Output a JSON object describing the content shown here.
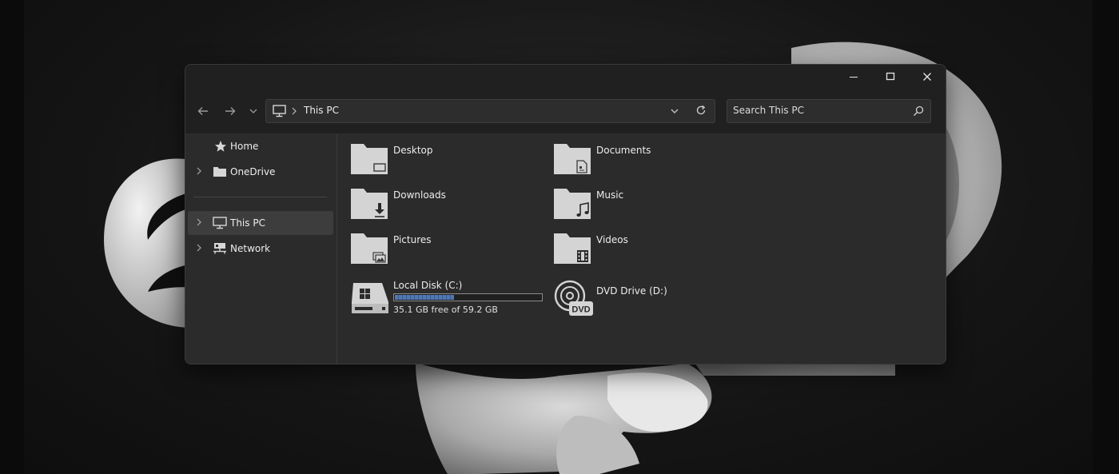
{
  "window": {
    "title": "This PC"
  },
  "caption": {
    "minimize": "minimize",
    "maximize": "maximize",
    "close": "close"
  },
  "address": {
    "location": "This PC"
  },
  "search": {
    "placeholder": "Search This PC"
  },
  "sidebar": {
    "items": [
      {
        "label": "Home",
        "icon": "home-star-icon"
      },
      {
        "label": "OneDrive",
        "icon": "folder-icon",
        "expandable": true
      },
      {
        "label": "This PC",
        "icon": "monitor-icon",
        "expandable": true,
        "selected": true
      },
      {
        "label": "Network",
        "icon": "network-icon",
        "expandable": true
      }
    ]
  },
  "folders": [
    {
      "label": "Desktop",
      "icon": "desktop-folder-icon"
    },
    {
      "label": "Documents",
      "icon": "documents-folder-icon"
    },
    {
      "label": "Downloads",
      "icon": "downloads-folder-icon"
    },
    {
      "label": "Music",
      "icon": "music-folder-icon"
    },
    {
      "label": "Pictures",
      "icon": "pictures-folder-icon"
    },
    {
      "label": "Videos",
      "icon": "videos-folder-icon"
    }
  ],
  "drives": [
    {
      "label": "Local Disk (C:)",
      "free_text": "35.1 GB free of 59.2 GB",
      "used_fraction": 0.407
    },
    {
      "label": "DVD Drive (D:)",
      "badge": "DVD"
    }
  ],
  "colors": {
    "usage_bar": "#4f78b8",
    "window_bg": "#2b2b2b",
    "titlebar_bg": "#202020"
  }
}
